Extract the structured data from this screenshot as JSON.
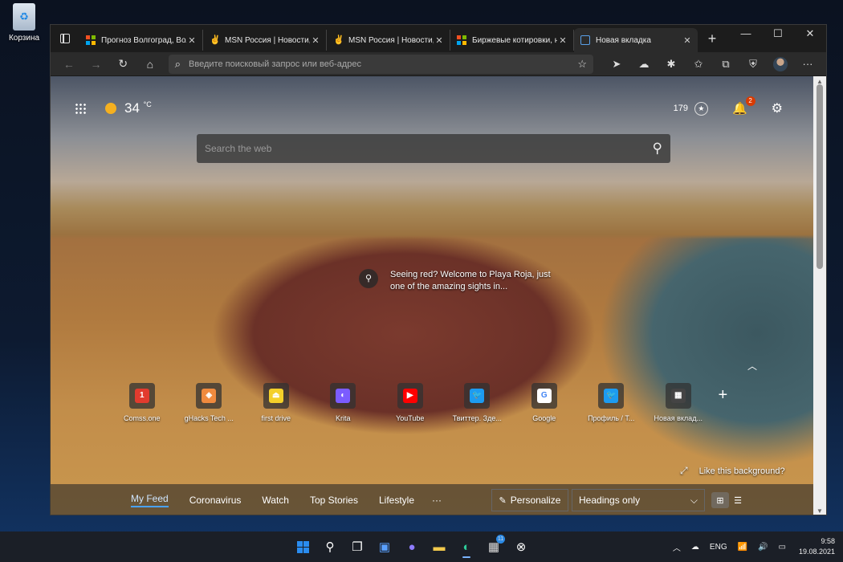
{
  "desktop": {
    "recycle_bin_label": "Корзина"
  },
  "tabs": [
    {
      "title": "Прогноз Волгоград, Вол",
      "favicon": "microsoft-icon"
    },
    {
      "title": "MSN Россия | Новости, с",
      "favicon": "msn-icon"
    },
    {
      "title": "MSN Россия | Новости, с",
      "favicon": "msn-icon"
    },
    {
      "title": "Биржевые котировки, н",
      "favicon": "microsoft-icon"
    },
    {
      "title": "Новая вкладка",
      "favicon": "newtab-icon",
      "active": true
    }
  ],
  "addressbar": {
    "placeholder": "Введите поисковый запрос или веб-адрес"
  },
  "newtab": {
    "temperature": "34",
    "temperature_unit": "°C",
    "rewards_points": "179",
    "notification_count": "2",
    "search_placeholder": "Search the web",
    "image_caption": "Seeing red? Welcome to Playa Roja, just one of the amazing sights in...",
    "like_background": "Like this background?",
    "quick_links": [
      {
        "label": "Comss.one",
        "icon": "comss-icon",
        "color": "#e23b2e",
        "glyph": "1"
      },
      {
        "label": "gHacks Tech ...",
        "icon": "ghacks-icon",
        "color": "#f08a3e",
        "glyph": "◈"
      },
      {
        "label": "first drive",
        "icon": "firstdrive-icon",
        "color": "#f4d02a",
        "glyph": "⏏"
      },
      {
        "label": "Krita",
        "icon": "krita-icon",
        "color": "#7b5cff",
        "glyph": "◐"
      },
      {
        "label": "YouTube",
        "icon": "youtube-icon",
        "color": "#ff0000",
        "glyph": "▶"
      },
      {
        "label": "Твиттер. Зде...",
        "icon": "twitter-icon",
        "color": "#1d9bf0",
        "glyph": "🐦"
      },
      {
        "label": "Google",
        "icon": "google-icon",
        "color": "#ffffff",
        "glyph": "G"
      },
      {
        "label": "Профиль / Т...",
        "icon": "twitter-icon",
        "color": "#1d9bf0",
        "glyph": "🐦"
      },
      {
        "label": "Новая вклад...",
        "icon": "page-icon",
        "color": "#444444",
        "glyph": "▦"
      }
    ],
    "feed_tabs": [
      {
        "label": "My Feed",
        "active": true
      },
      {
        "label": "Coronavirus"
      },
      {
        "label": "Watch"
      },
      {
        "label": "Top Stories"
      },
      {
        "label": "Lifestyle"
      }
    ],
    "more_label": "···",
    "personalize_label": "Personalize",
    "layout_select": "Headings only"
  },
  "taskbar": {
    "store_badge": "11",
    "language": "ENG",
    "time": "9:58",
    "date": "19.08.2021"
  }
}
